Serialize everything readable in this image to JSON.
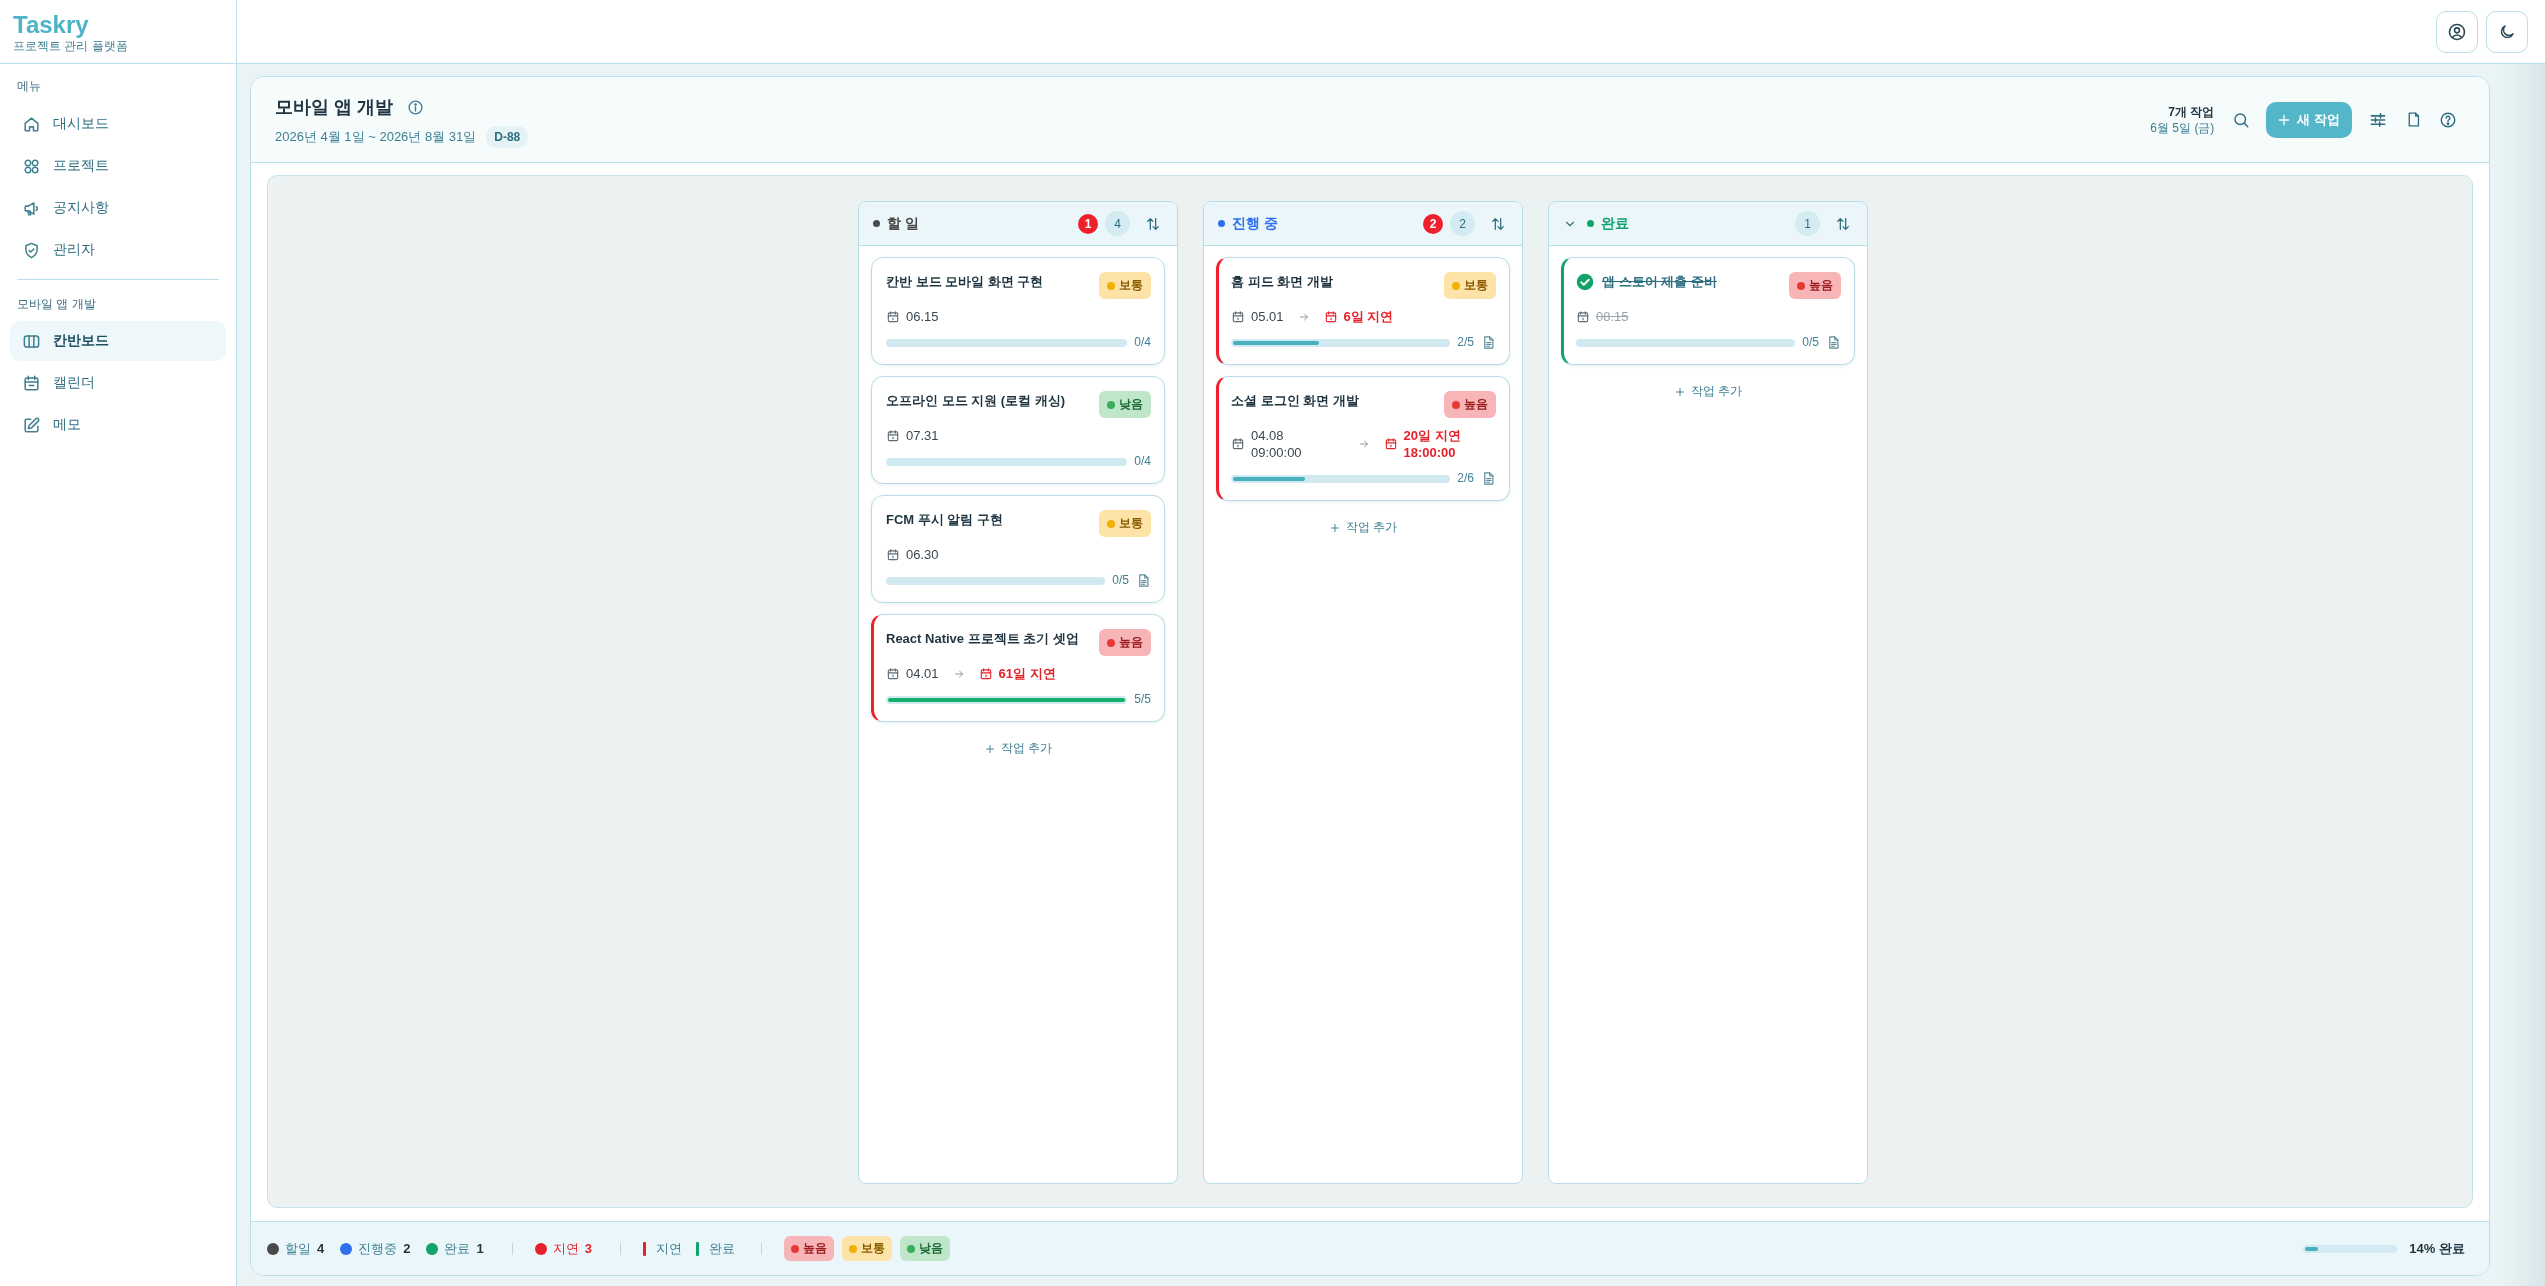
{
  "sidebar": {
    "brand": "Taskry",
    "tagline": "프로젝트 관리 플랫폼",
    "sections": [
      {
        "title": "메뉴",
        "items": [
          {
            "label": "대시보드",
            "selected": false
          },
          {
            "label": "프로젝트",
            "selected": false
          },
          {
            "label": "공지사항",
            "selected": false
          },
          {
            "label": "관리자",
            "selected": false
          }
        ]
      },
      {
        "title": "모바일 앱 개발",
        "items": [
          {
            "label": "칸반보드",
            "selected": true
          },
          {
            "label": "캘린더",
            "selected": false
          },
          {
            "label": "메모",
            "selected": false
          }
        ]
      }
    ]
  },
  "project": {
    "title": "모바일 앱 개발",
    "period": "2026년 4월 1일 ~ 2026년 8월 31일",
    "d_day": "D-88",
    "task_count": "7개 작업",
    "today": "6월 5일 (금)",
    "new_task_button": "새 작업"
  },
  "board": {
    "columns": [
      {
        "title": "할 일",
        "color": "#4a4a4a",
        "collapsible": false,
        "overdue_count": "1",
        "count": "4",
        "add_label": "작업 추가",
        "cards": [
          {
            "title": "칸반 보드 모바일 화면 구현",
            "priority": {
              "kind": "medium",
              "label": "보통"
            },
            "due": "06.15",
            "overdue": false,
            "done": false,
            "progress": "0/4",
            "attachment": false
          },
          {
            "title": "오프라인 모드 지원 (로컬 캐싱)",
            "priority": {
              "kind": "low",
              "label": "낮음"
            },
            "due": "07.31",
            "overdue": false,
            "done": false,
            "progress": "0/4",
            "attachment": false
          },
          {
            "title": "FCM 푸시 알림 구현",
            "priority": {
              "kind": "medium",
              "label": "보통"
            },
            "due": "06.30",
            "overdue": false,
            "done": false,
            "progress": "0/5",
            "attachment": true
          },
          {
            "title": "React Native 프로젝트 초기 셋업",
            "priority": {
              "kind": "high",
              "label": "높음"
            },
            "start": "04.01",
            "due": "61일 지연",
            "overdue": true,
            "done": false,
            "progress": "5/5",
            "level": 1,
            "attachment": false
          }
        ]
      },
      {
        "title": "진행 중",
        "color": "#2f6fed",
        "collapsible": false,
        "overdue_count": "2",
        "count": "2",
        "add_label": "작업 추가",
        "cards": [
          {
            "title": "홈 피드 화면 개발",
            "priority": {
              "kind": "medium",
              "label": "보통"
            },
            "start": "05.01",
            "due": "6일 지연",
            "overdue": true,
            "done": false,
            "progress": "2/5",
            "level": 0.4,
            "attachment": true
          },
          {
            "title": "소셜 로그인 화면 개발",
            "priority": {
              "kind": "high",
              "label": "높음"
            },
            "start": "04.08",
            "start_time": "09:00:00",
            "due": "20일 지연",
            "due_time": "18:00:00",
            "overdue": true,
            "done": false,
            "progress": "2/6",
            "level": 0.333,
            "attachment": true
          }
        ]
      },
      {
        "title": "완료",
        "color": "#12a36b",
        "collapsible": true,
        "count": "1",
        "add_label": "작업 추가",
        "cards": [
          {
            "title": "앱 스토어 제출 준비",
            "priority": {
              "kind": "high",
              "label": "높음"
            },
            "due": "08.15",
            "overdue": false,
            "done": true,
            "progress": "0/5",
            "attachment": true
          }
        ]
      }
    ]
  },
  "footer": {
    "status_counts": [
      {
        "label": "할일",
        "count": "4",
        "color": "#4a4a4a"
      },
      {
        "label": "진행중",
        "count": "2",
        "color": "#2f6fed"
      },
      {
        "label": "완료",
        "count": "1",
        "color": "#12a36b"
      }
    ],
    "overdue": {
      "label": "지연",
      "count": "3",
      "color": "#e5222a"
    },
    "border_legend": [
      {
        "label": "지연",
        "color": "#e5222a"
      },
      {
        "label": "완료",
        "color": "#12a36b"
      }
    ],
    "priorities": [
      {
        "kind": "high",
        "label": "높음"
      },
      {
        "kind": "medium",
        "label": "보통"
      },
      {
        "kind": "low",
        "label": "낮음"
      }
    ],
    "progress": {
      "level": 0.14,
      "label": "14% 완료"
    }
  }
}
